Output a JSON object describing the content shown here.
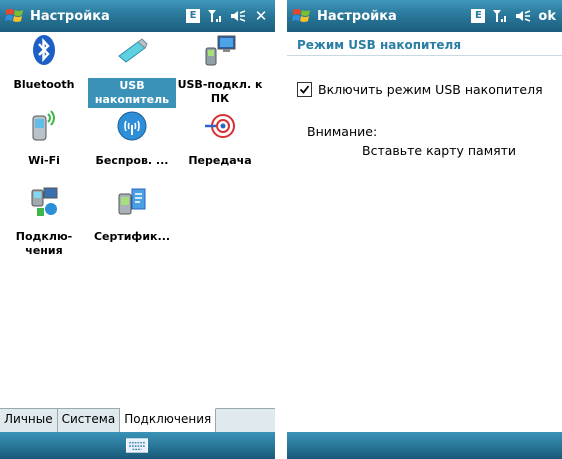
{
  "left_screen": {
    "title": "Настройка",
    "tray": {
      "edge_indicator": "E",
      "signal_icon": "signal-icon",
      "volume_icon": "speaker-icon",
      "close_label": "✕"
    },
    "items": [
      {
        "label": "Bluetooth",
        "icon": "bluetooth-icon",
        "selected": false
      },
      {
        "label": "USB накопитель",
        "icon": "usb-drive-icon",
        "selected": true
      },
      {
        "label": "USB-подкл. к ПК",
        "icon": "usb-to-pc-icon",
        "selected": false
      },
      {
        "label": "Wi-Fi",
        "icon": "wifi-icon",
        "selected": false
      },
      {
        "label": "Беспров. ...",
        "icon": "wireless-icon",
        "selected": false
      },
      {
        "label": "Передача",
        "icon": "beam-icon",
        "selected": false
      },
      {
        "label": "Подклю-чения",
        "icon": "connections-icon",
        "selected": false
      },
      {
        "label": "Сертифик...",
        "icon": "certificates-icon",
        "selected": false
      }
    ],
    "tabs": [
      {
        "label": "Личные",
        "active": false
      },
      {
        "label": "Система",
        "active": false
      },
      {
        "label": "Подключения",
        "active": true
      }
    ],
    "softbar": {
      "keyboard_icon": "keyboard-icon"
    }
  },
  "right_screen": {
    "title": "Настройка",
    "tray": {
      "edge_indicator": "E",
      "signal_icon": "signal-icon",
      "volume_icon": "speaker-icon",
      "ok_label": "ok"
    },
    "section_title": "Режим USB накопителя",
    "checkbox": {
      "label": "Включить режим USB накопителя",
      "checked": true
    },
    "warning_label": "Внимание:",
    "warning_text": "Вставьте карту памяти"
  },
  "colors": {
    "titlebar": "#2c7c9f",
    "selection": "#3a92b8",
    "section_title": "#2b7ea4"
  }
}
